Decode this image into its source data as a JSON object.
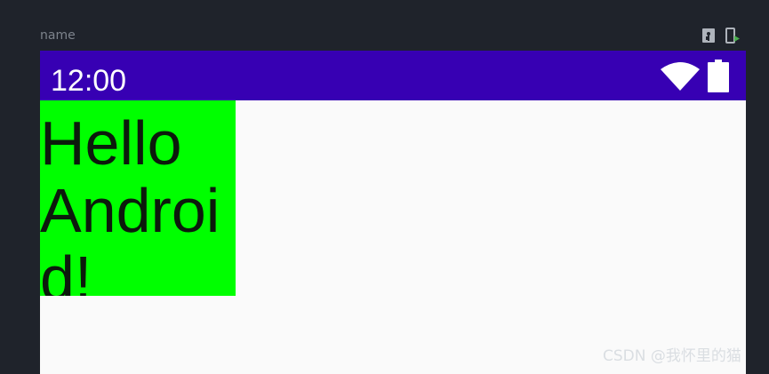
{
  "preview": {
    "name": "name",
    "toolbar_icons": [
      "device-interactive-icon",
      "deploy-to-device-icon"
    ]
  },
  "device": {
    "status_bar": {
      "time": "12:00",
      "icons": [
        "wifi-icon",
        "battery-icon"
      ],
      "color": "#3700b3"
    },
    "background": "#fafafa",
    "text_view": {
      "text": "Hello Android!",
      "background": "#00ff00",
      "text_color": "#0c1a0c"
    }
  },
  "watermark": "CSDN @我怀里的猫"
}
